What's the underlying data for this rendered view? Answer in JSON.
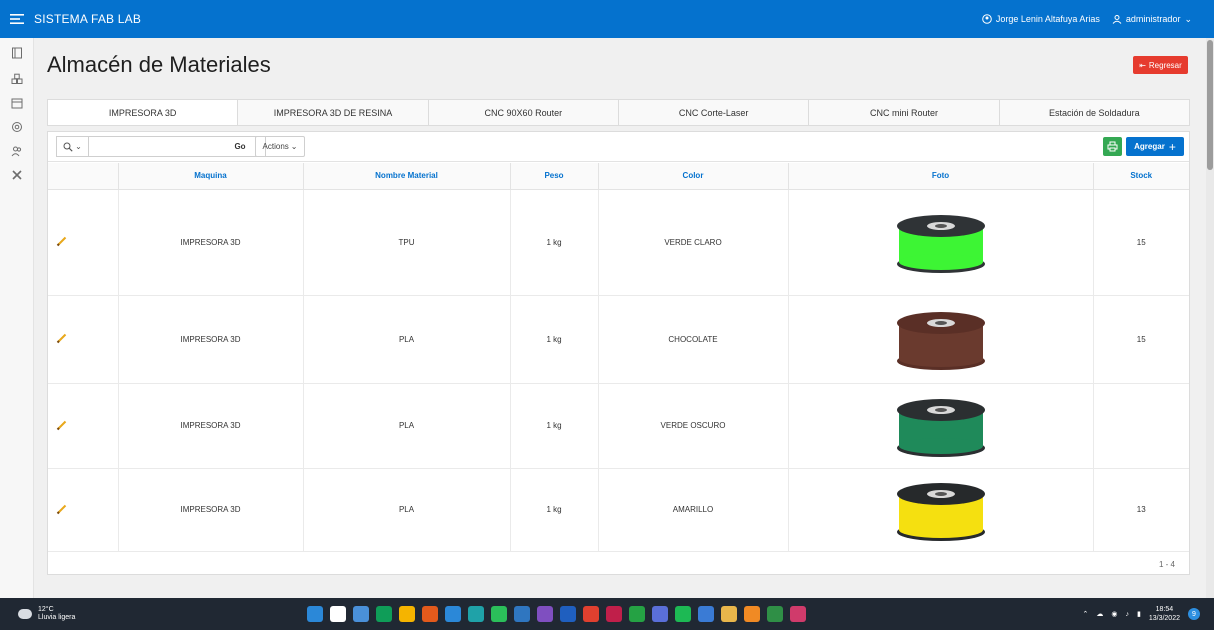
{
  "header": {
    "app_title": "SISTEMA FAB LAB",
    "user_name": "Jorge Lenin Altafuya Arias",
    "role_label": "administrador"
  },
  "page": {
    "title": "Almacén de Materiales",
    "back_button": "Regresar"
  },
  "tabs": [
    {
      "label": "IMPRESORA 3D",
      "active": true
    },
    {
      "label": "IMPRESORA 3D DE RESINA",
      "active": false
    },
    {
      "label": "CNC 90X60 Router",
      "active": false
    },
    {
      "label": "CNC Corte-Laser",
      "active": false
    },
    {
      "label": "CNC mini Router",
      "active": false
    },
    {
      "label": "Estación de Soldadura",
      "active": false
    }
  ],
  "toolbar": {
    "search_value": "",
    "go_label": "Go",
    "actions_label": "Actions",
    "add_label": "Agregar"
  },
  "table": {
    "columns": [
      "Maquina",
      "Nombre Material",
      "Peso",
      "Color",
      "Foto",
      "Stock"
    ],
    "rows": [
      {
        "maquina": "IMPRESORA 3D",
        "material": "TPU",
        "peso": "1 kg",
        "color": "VERDE CLARO",
        "stock": "15",
        "spool_color": "#3df534",
        "spool_flange": "#2f3336"
      },
      {
        "maquina": "IMPRESORA 3D",
        "material": "PLA",
        "peso": "1 kg",
        "color": "CHOCOLATE",
        "stock": "15",
        "spool_color": "#6a3a2e",
        "spool_flange": "#5a2f26"
      },
      {
        "maquina": "IMPRESORA 3D",
        "material": "PLA",
        "peso": "1 kg",
        "color": "VERDE OSCURO",
        "stock": "",
        "spool_color": "#1f8a5a",
        "spool_flange": "#2b2f31"
      },
      {
        "maquina": "IMPRESORA 3D",
        "material": "PLA",
        "peso": "1 kg",
        "color": "AMARILLO",
        "stock": "13",
        "spool_color": "#f5e010",
        "spool_flange": "#26292b"
      }
    ],
    "pagination": "1 - 4"
  },
  "taskbar": {
    "temperature": "12°C",
    "weather": "Lluvia ligera",
    "time": "18:54",
    "date": "13/3/2022",
    "app_colors": [
      "#2b88d8",
      "#ffffff",
      "#4a90d9",
      "#0f9d58",
      "#f5b400",
      "#e25a1c",
      "#2b88d8",
      "#1fa2a8",
      "#2bbf5a",
      "#2f76c0",
      "#7f4fc0",
      "#1f5fbf",
      "#e0402f",
      "#c01f4a",
      "#25a244",
      "#5a6fd8",
      "#1db954",
      "#3a7bd5",
      "#e8b64b",
      "#f08a24",
      "#2f8f46",
      "#d03b6b"
    ]
  },
  "colors": {
    "primary": "#0572ce",
    "danger": "#e63b2e",
    "success": "#34a853"
  }
}
